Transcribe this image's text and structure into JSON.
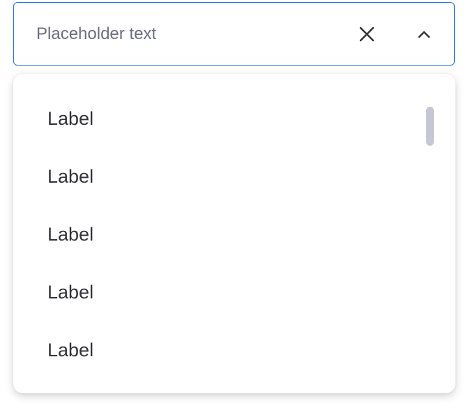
{
  "combobox": {
    "placeholder": "Placeholder text",
    "clear_icon": "close-icon",
    "toggle_icon": "chevron-up-icon",
    "accent_color": "#1f76e8"
  },
  "menu": {
    "items": [
      {
        "label": "Label"
      },
      {
        "label": "Label"
      },
      {
        "label": "Label"
      },
      {
        "label": "Label"
      },
      {
        "label": "Label"
      }
    ]
  }
}
